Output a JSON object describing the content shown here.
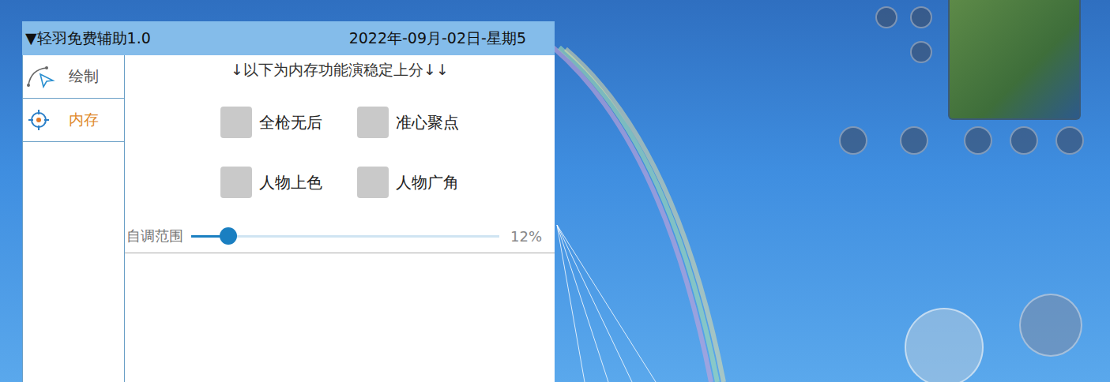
{
  "menu": {
    "title": "▼轻羽免费辅助1.0",
    "date": "2022年-09月-02日-星期5"
  },
  "sidebar": {
    "items": [
      {
        "label": "绘制",
        "selected": false
      },
      {
        "label": "内存",
        "selected": true
      }
    ]
  },
  "content": {
    "heading": "↓以下为内存功能演稳定上分↓↓",
    "toggles": [
      {
        "label": "全枪无后",
        "checked": false
      },
      {
        "label": "准心聚点",
        "checked": false
      },
      {
        "label": "人物上色",
        "checked": false
      },
      {
        "label": "人物广角",
        "checked": false
      }
    ],
    "slider": {
      "label": "自调范围",
      "level": 0.12,
      "reading": "12%"
    }
  }
}
